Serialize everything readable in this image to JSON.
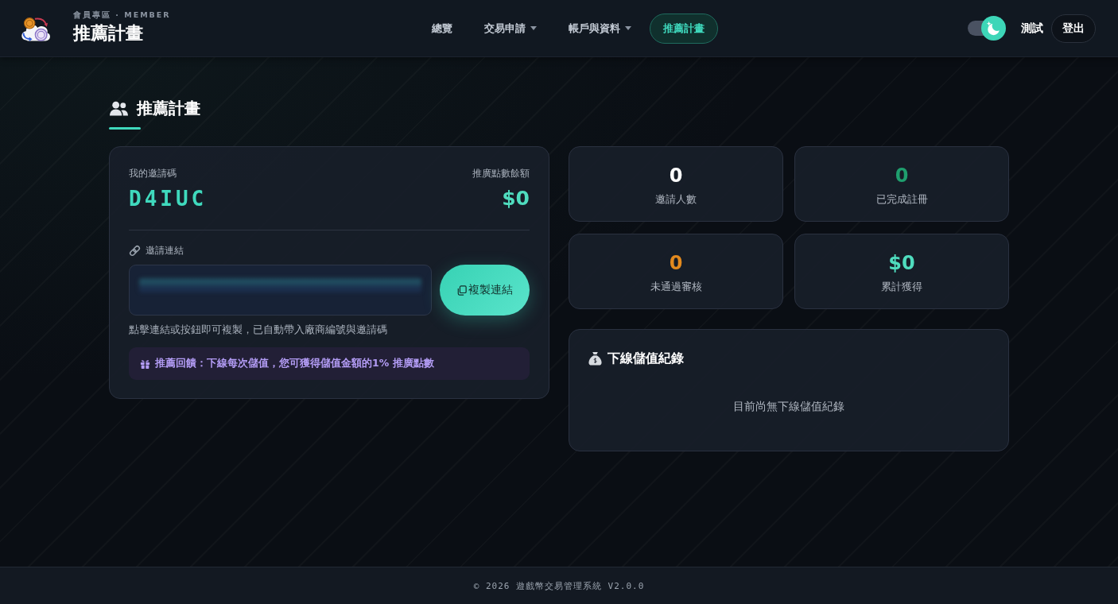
{
  "header": {
    "caption": "會員專區 · MEMBER",
    "title": "推薦計畫",
    "nav": [
      {
        "label": "總覽",
        "kind": "link",
        "selected": false
      },
      {
        "label": "交易申請",
        "kind": "dropdown",
        "selected": false
      },
      {
        "label": "帳戶與資料",
        "kind": "dropdown",
        "selected": false
      },
      {
        "label": "推薦計畫",
        "kind": "link",
        "selected": true
      }
    ],
    "theme_toggle": {
      "on": true
    },
    "user_name": "測試",
    "logout_button": "登出"
  },
  "page_title": "推薦計畫",
  "invite_card": {
    "code_label": "我的邀請碼",
    "code": "D4IUC",
    "balance_label": "推廣點數餘額",
    "balance": "$0",
    "link_label": "邀請連結",
    "link_field": {
      "blurred": true
    },
    "copy_button": "複製連結",
    "hint": "點擊連結或按鈕即可複製，已自動帶入廠商編號與邀請碼",
    "reward_note": "推薦回饋：下線每次儲值，您可獲得儲值金額的**1%** 推廣點數"
  },
  "stats": [
    {
      "value": "0",
      "label": "邀請人數",
      "color": "#ffffff"
    },
    {
      "value": "0",
      "label": "已完成註冊",
      "color": "#1f9f6e"
    },
    {
      "value": "0",
      "label": "未通過審核",
      "color": "#e38a1e"
    },
    {
      "value": "$0",
      "label": "累計獲得",
      "color": "#4fdcbe"
    }
  ],
  "records": {
    "title": "下線儲值紀錄",
    "empty_message": "目前尚無下線儲值紀錄"
  },
  "footer": "© 2026 遊戲幣交易管理系統 V2.0.0"
}
